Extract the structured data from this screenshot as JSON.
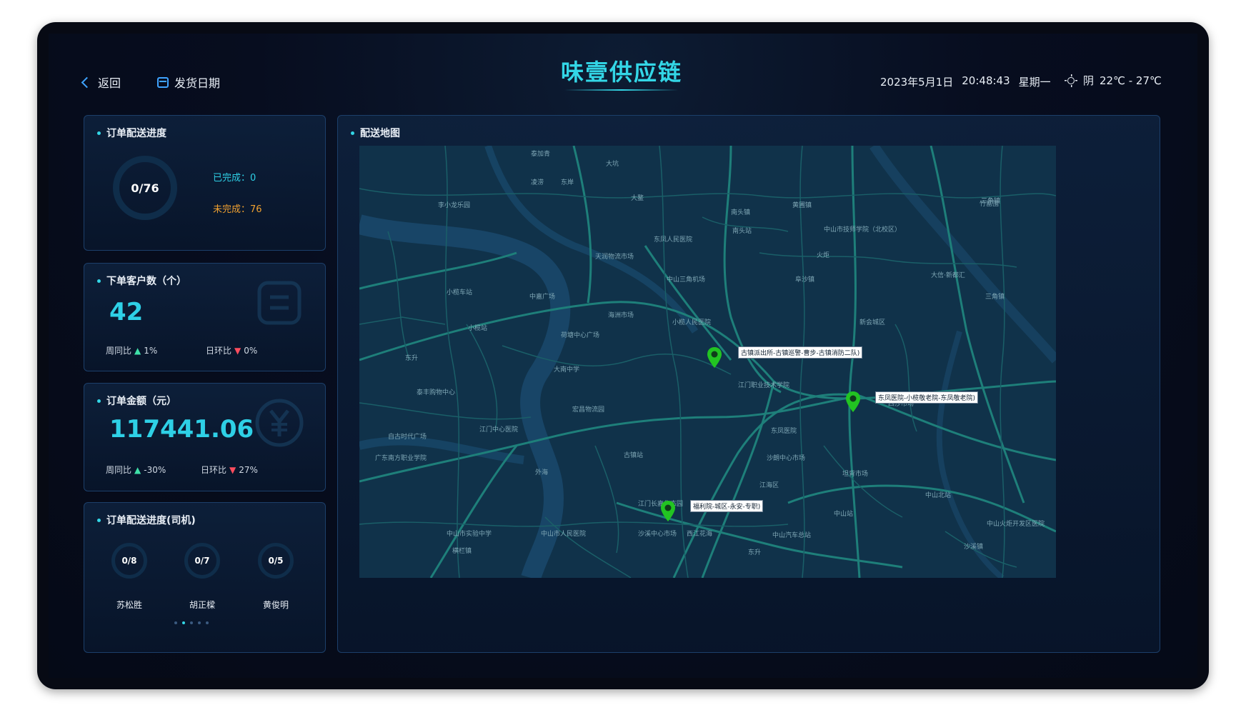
{
  "header": {
    "back_label": "返回",
    "date_label": "发货日期",
    "title": "味壹供应链",
    "date": "2023年5月1日",
    "time": "20:48:43",
    "weekday": "星期一",
    "weather": "阴",
    "temp": "22℃ - 27℃"
  },
  "delivery_progress": {
    "title": "订单配送进度",
    "ring_text": "0/76",
    "done_label": "已完成：",
    "done_value": "0",
    "undone_label": "未完成：",
    "undone_value": "76"
  },
  "customers": {
    "title": "下单客户数（个）",
    "value": "42",
    "wow_label": "周同比",
    "wow_value": "1%",
    "dod_label": "日环比",
    "dod_value": "0%"
  },
  "amount": {
    "title": "订单金额（元）",
    "value": "117441.06",
    "wow_label": "周同比",
    "wow_value": "-30%",
    "dod_label": "日环比",
    "dod_value": "27%"
  },
  "drivers": {
    "title": "订单配送进度(司机)",
    "items": [
      {
        "progress": "0/8",
        "name": "苏松胜"
      },
      {
        "progress": "0/7",
        "name": "胡正樑"
      },
      {
        "progress": "0/5",
        "name": "黄俊明"
      }
    ],
    "pages": 5,
    "active_page": 2
  },
  "map": {
    "title": "配送地图",
    "markers": [
      {
        "label": "古镇派出所-古镇巡警-曹步-古镇消防二队)"
      },
      {
        "label": "东凤医院-小榄敬老院-东凤敬老院)"
      },
      {
        "label": "福利院-城区-永安-专职)"
      }
    ],
    "places": [
      "大坑",
      "凌涝",
      "东岸",
      "南头镇",
      "黄圃镇",
      "三角镇",
      "李小龙乐园",
      "南头站",
      "中山市技师学院（北校区）",
      "竹富围",
      "东凤人民医院",
      "阜沙镇",
      "火炬",
      "三角镇",
      "中山三角机场",
      "小榄车站",
      "中嘉广场",
      "海洲市场",
      "小榄人民医院",
      "小榄站",
      "荷塘中心广场",
      "大信·新都汇",
      "东升",
      "大南中学",
      "江门职业技术学院",
      "古镇镇",
      "泰丰购物中心",
      "宏昌物流园",
      "东凤医院",
      "江门中心医院",
      "古镇站",
      "坦背市场",
      "广东南方职业学院",
      "四沙市场",
      "中山北站",
      "江海区",
      "外海",
      "沙朗中心市场",
      "中山站",
      "中山火炬开发区医院",
      "西江花海",
      "东升",
      "沙溪镇",
      "中山市人民医院",
      "中山汽车总站",
      "中山市实验中学",
      "江门长嘉生态园",
      "沙溪中心市场",
      "横栏镇",
      "泰加青",
      "大鳌",
      "天润物流市场",
      "自古时代广场",
      "新会城区"
    ]
  },
  "colors": {
    "accent": "#33d6e6",
    "link_blue": "#3fa3ff",
    "done_green": "#2ed0e6",
    "undone_orange": "#f0a030",
    "up": "#3fe0a8",
    "down": "#ff4d5e",
    "marker": "#22c422"
  }
}
